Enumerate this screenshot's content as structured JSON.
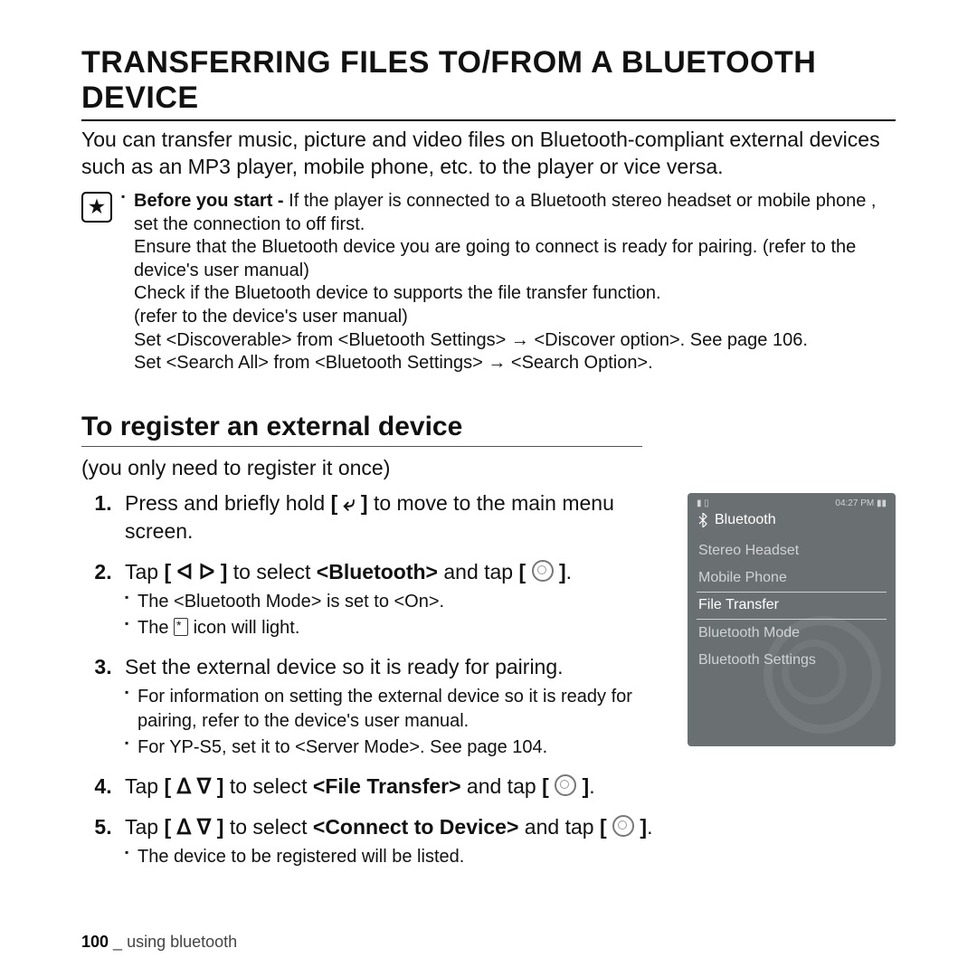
{
  "page": {
    "title": "TRANSFERRING FILES TO/FROM A BLUETOOTH DEVICE",
    "intro": "You can transfer music, picture and video files on Bluetooth-compliant external devices such as an MP3 player, mobile phone, etc. to the player or vice versa.",
    "note": {
      "l1a": "Before you start - ",
      "l1b": "If the player is connected to a Bluetooth stereo headset or mobile phone , set the connection to off first.",
      "l2": "Ensure that the Bluetooth device you are going to connect is ready for pairing. (refer to the device's user manual)",
      "l3": "Check if the Bluetooth device to supports the file transfer function.",
      "l4": "(refer to the device's user manual)",
      "l5": "Set <Discoverable> from <Bluetooth Settings> → <Discover option>. See page 106.",
      "l6": "Set <Search All> from <Bluetooth Settings> → <Search Option>."
    },
    "h2": "To register an external device",
    "sub": "(you only need to register it once)",
    "steps": {
      "s1a": "Press and briefly hold ",
      "s1b": " to move to the main menu screen.",
      "s2a": "Tap ",
      "s2b": " to select ",
      "s2c": "<Bluetooth>",
      "s2d": " and tap ",
      "s2sub1": "The <Bluetooth Mode> is set to <On>.",
      "s2sub2a": "The ",
      "s2sub2b": " icon will light.",
      "s3": "Set the external device so it is ready for pairing.",
      "s3sub1": "For information on setting the external device so it is ready for pairing, refer to the device's user manual.",
      "s3sub2": "For YP-S5, set it to <Server Mode>. See page 104.",
      "s4a": "Tap ",
      "s4b": " to select ",
      "s4c": "<File Transfer>",
      "s4d": " and tap ",
      "s5a": "Tap ",
      "s5b": " to select ",
      "s5c": "<Connect to Device>",
      "s5d": " and tap ",
      "s5sub1": "The device to be registered will be listed."
    },
    "keys": {
      "back": "[ ⤶ ]",
      "lr": "[ ᐊ  ᐅ ]",
      "ud": "[ ᐃ  ᐁ ]"
    },
    "device": {
      "time": "04:27 PM",
      "title": "Bluetooth",
      "items": [
        "Stereo Headset",
        "Mobile Phone",
        "File Transfer",
        "Bluetooth Mode",
        "Bluetooth Settings"
      ]
    },
    "footer": {
      "num": "100",
      "sep": " _ ",
      "label": "using bluetooth"
    }
  }
}
